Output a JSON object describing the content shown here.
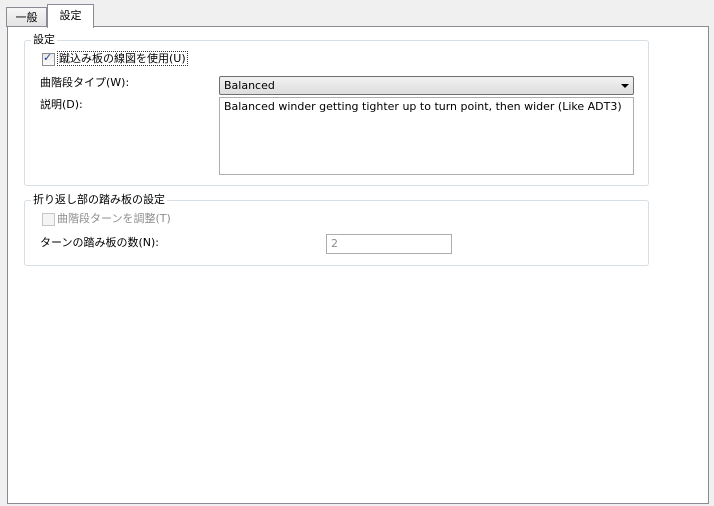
{
  "tabs": {
    "general": "一般",
    "settings": "設定"
  },
  "group1": {
    "title": "設定",
    "use_winder_lines_label": "蹴込み板の線図を使用(U)",
    "use_winder_lines_checked": true,
    "curved_type_label": "曲階段タイプ(W):",
    "curved_type_value": "Balanced",
    "description_label": "説明(D):",
    "description_text": "Balanced winder getting tighter up to turn point, then wider (Like ADT3)"
  },
  "group2": {
    "title": "折り返し部の踏み板の設定",
    "adjust_turn_label": "曲階段ターンを調整(T)",
    "adjust_turn_checked": false,
    "turn_treads_label": "ターンの踏み板の数(N):",
    "turn_treads_value": "2"
  },
  "icons": {
    "check": "checkmark-icon",
    "dropdown": "chevron-down-icon"
  }
}
